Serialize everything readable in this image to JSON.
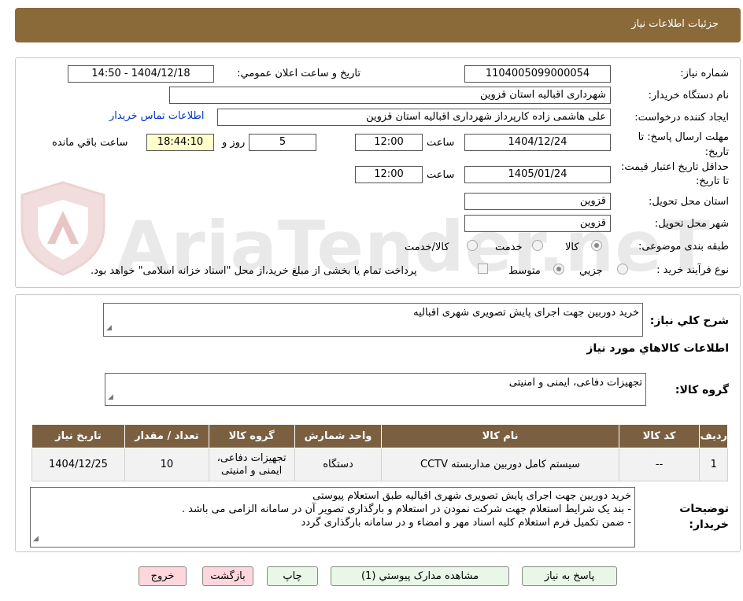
{
  "header": {
    "title": "جزئیات اطلاعات نیاز"
  },
  "watermark": {
    "text": "AriaTender.neT"
  },
  "form": {
    "need_number_label": "شماره نیاز:",
    "need_number": "1104005099000054",
    "announce_label": "تاریخ و ساعت اعلان عمومي:",
    "announce_value": "1404/12/18 - 14:50",
    "buyer_label": "نام دستگاه خریدار:",
    "buyer_value": "شهرداری اقبالیه استان قزوین",
    "creator_label": "ایجاد کننده درخواست:",
    "creator_value": "علی هاشمی زاده کارپرداز شهرداری اقبالیه استان قزوین",
    "contact_link": "اطلاعات تماس خریدار",
    "reply_label": "مهلت ارسال پاسخ: تا تاریخ:",
    "reply_date": "1404/12/24",
    "time_label": "ساعت",
    "reply_time": "12:00",
    "days_value": "5",
    "days_label": "روز و",
    "remaining_time": "18:44:10",
    "remaining_label": "ساعت باقي مانده",
    "validity_label": "حداقل تاریخ اعتبار قیمت: تا تاریخ:",
    "validity_date": "1405/01/24",
    "validity_time": "12:00",
    "province_label": "استان محل تحویل:",
    "province_value": "قزوین",
    "city_label": "شهر محل تحویل:",
    "city_value": "قزوین",
    "category_label": "طبقه بندی موضوعی:",
    "category_options": [
      "کالا",
      "خدمت",
      "کالا/خدمت"
    ],
    "category_selected": "کالا",
    "process_label": "نوع فرآیند خرید :",
    "process_options": [
      "جزیي",
      "متوسط"
    ],
    "process_selected": "متوسط",
    "payment_note": "پرداخت تمام یا بخشی از مبلغ خرید،از محل \"اسناد خزانه اسلامی\" خواهد بود."
  },
  "summary": {
    "desc_label": "شرح کلي نیاز:",
    "desc_value": "خرید دوربین جهت اجرای پایش تصویری شهری اقبالیه",
    "items_title": "اطلاعات کالاهاي مورد نیاز",
    "group_label": "گروه کالا:",
    "group_value": "تجهیزات دفاعی، ایمنی و امنیتی"
  },
  "table": {
    "headers": [
      "ردیف",
      "کد کالا",
      "نام کالا",
      "واحد شمارش",
      "گروه کالا",
      "تعداد / مقدار",
      "تاریخ نیاز"
    ],
    "rows": [
      [
        "1",
        "--",
        "سیستم کامل دوربین مداربسته CCTV",
        "دستگاه",
        "تجهیزات دفاعی، ایمنی و امنیتی",
        "10",
        "1404/12/25"
      ]
    ]
  },
  "notes": {
    "label": "توضیحات خریدار:",
    "lines": [
      "خرید دوربین جهت اجرای پایش تصویری شهری اقبالیه طبق استعلام پیوستی",
      "- بند یک شرایط استعلام جهت شرکت نمودن در استعلام و بارگذاری تصویر آن در سامانه الزامی می باشد .",
      "- ضمن تکمیل فرم استعلام کلیه اسناد مهر و امضاء و در سامانه بارگذاری گردد"
    ]
  },
  "buttons": {
    "reply": "پاسخ به نیاز",
    "attachments": "مشاهده مدارک پیوستي (1)",
    "print": "چاپ",
    "back": "بازگشت",
    "exit": "خروج"
  },
  "colors": {
    "header": "#8B6A3A",
    "table_header": "#7A6040",
    "link": "#0033CC",
    "green_button": "#E8F7E8",
    "pink_button": "#FFD6DC"
  }
}
